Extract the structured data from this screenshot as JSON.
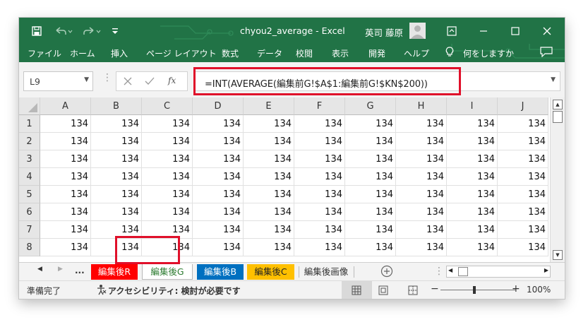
{
  "window": {
    "title": "chyou2_average  -  Excel",
    "user_name": "英司 藤原",
    "quick_access": {
      "save_icon": "save-icon",
      "undo_icon": "undo-icon",
      "redo_icon": "redo-icon",
      "customize_icon": "customize-qat-icon"
    }
  },
  "ribbon": {
    "tabs": [
      "ファイル",
      "ホーム",
      "挿入",
      "ページ レイアウト",
      "数式",
      "データ",
      "校閲",
      "表示",
      "開発",
      "ヘルプ"
    ],
    "search_label": "何をしますか"
  },
  "formula_bar": {
    "name_box": "L9",
    "fx_label": "fx",
    "formula": "=INT(AVERAGE(編集前G!$A$1:編集前G!$KN$200))"
  },
  "sheet": {
    "columns": [
      "A",
      "B",
      "C",
      "D",
      "E",
      "F",
      "G",
      "H",
      "I",
      "J"
    ],
    "rows": [
      {
        "header": "1",
        "cells": [
          "134",
          "134",
          "134",
          "134",
          "134",
          "134",
          "134",
          "134",
          "134",
          "134"
        ]
      },
      {
        "header": "2",
        "cells": [
          "134",
          "134",
          "134",
          "134",
          "134",
          "134",
          "134",
          "134",
          "134",
          "134"
        ]
      },
      {
        "header": "3",
        "cells": [
          "134",
          "134",
          "134",
          "134",
          "134",
          "134",
          "134",
          "134",
          "134",
          "134"
        ]
      },
      {
        "header": "4",
        "cells": [
          "134",
          "134",
          "134",
          "134",
          "134",
          "134",
          "134",
          "134",
          "134",
          "134"
        ]
      },
      {
        "header": "5",
        "cells": [
          "134",
          "134",
          "134",
          "134",
          "134",
          "134",
          "134",
          "134",
          "134",
          "134"
        ]
      },
      {
        "header": "6",
        "cells": [
          "134",
          "134",
          "134",
          "134",
          "134",
          "134",
          "134",
          "134",
          "134",
          "134"
        ]
      },
      {
        "header": "7",
        "cells": [
          "134",
          "134",
          "134",
          "134",
          "134",
          "134",
          "134",
          "134",
          "134",
          "134"
        ]
      },
      {
        "header": "8",
        "cells": [
          "134",
          "134",
          "134",
          "134",
          "134",
          "134",
          "134",
          "134",
          "134",
          "134"
        ]
      }
    ]
  },
  "sheet_tabs": {
    "overflow": "...",
    "tabs": [
      {
        "label": "編集後R",
        "bg": "#ff0000",
        "color": "#ffffff",
        "active": false
      },
      {
        "label": "編集後G",
        "bg": "#ffffff",
        "color": "#2e7d32",
        "active": true
      },
      {
        "label": "編集後B",
        "bg": "#0070c0",
        "color": "#ffffff",
        "active": false
      },
      {
        "label": "編集後C",
        "bg": "#ffc000",
        "color": "#222222",
        "active": false
      },
      {
        "label": "編集後画像",
        "bg": "#f3f3f3",
        "color": "#333333",
        "active": false
      }
    ]
  },
  "status_bar": {
    "ready": "準備完了",
    "accessibility": "アクセシビリティ: 検討が必要です",
    "zoom": "100%"
  },
  "colors": {
    "excel_green": "#217346",
    "highlight_red": "#e0102a"
  }
}
